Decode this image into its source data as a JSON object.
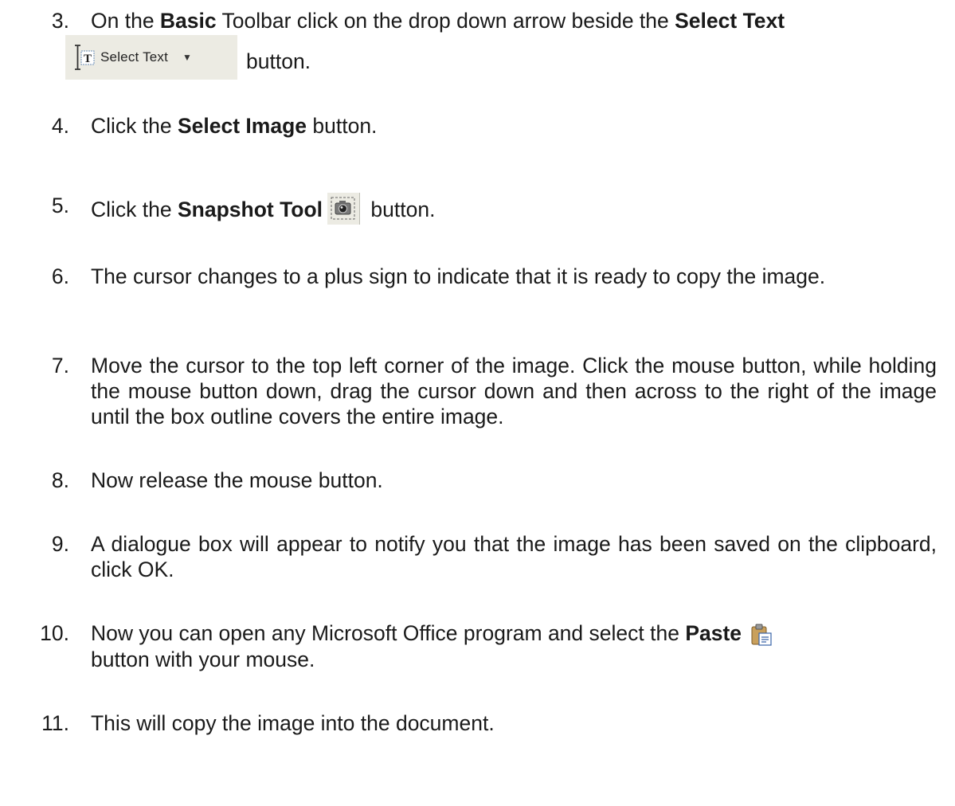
{
  "steps": [
    {
      "number": "3.",
      "text_1": "On the ",
      "bold_1": "Basic",
      "text_2": " Toolbar click on the drop down arrow beside the ",
      "bold_2": "Select Text",
      "button_label": "Select Text",
      "after_button": "button."
    },
    {
      "number": "4.",
      "text_1": "Click the ",
      "bold_1": "Select Image",
      "text_2": " button."
    },
    {
      "number": "5.",
      "text_1": "Click the ",
      "bold_1": "Snapshot Tool",
      "text_2": " button."
    },
    {
      "number": "6.",
      "text": "The cursor changes to a plus sign to indicate that it is ready to copy the image."
    },
    {
      "number": "7.",
      "text": "Move the cursor to the top left corner of the image.  Click the mouse button, while holding the mouse button down, drag the cursor down and then across to the right of the image until the box outline covers the entire image."
    },
    {
      "number": "8.",
      "text": "Now release the mouse button."
    },
    {
      "number": "9.",
      "text": "A dialogue box will appear to notify you that the image has been saved on the clipboard, click OK."
    },
    {
      "number": "10.",
      "text_1": "Now you can open any Microsoft Office program and select the ",
      "bold_1": "Paste",
      "text_2": "button with your mouse."
    },
    {
      "number": "11.",
      "text": "This will copy the image into the document."
    }
  ],
  "icons": {
    "select_text": "select-text-icon",
    "dropdown": "dropdown-arrow-icon",
    "snapshot": "snapshot-tool-icon",
    "paste": "paste-icon"
  },
  "colors": {
    "text": "#1a1a1a",
    "toolbar_bg": "#ecebe3"
  }
}
